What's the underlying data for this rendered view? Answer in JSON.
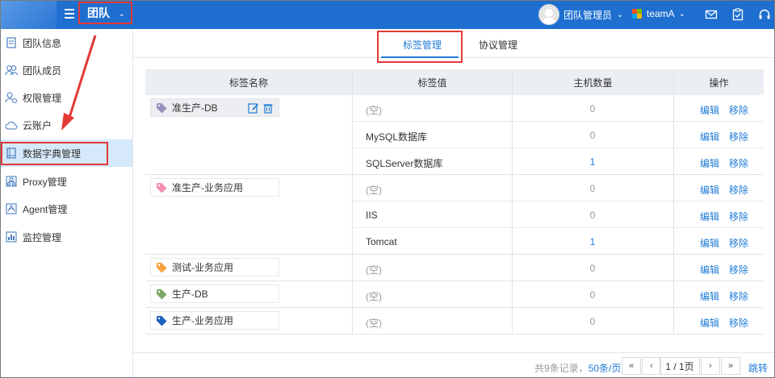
{
  "header": {
    "team_label": "团队",
    "user_name": "团队管理员",
    "team_name": "teamA",
    "icons": [
      "menu-icon",
      "mail-icon",
      "clipboard-icon",
      "headset-icon"
    ]
  },
  "sidebar": {
    "items": [
      {
        "label": "团队信息",
        "icon": "document-icon"
      },
      {
        "label": "团队成员",
        "icon": "people-icon"
      },
      {
        "label": "权限管理",
        "icon": "user-gear-icon"
      },
      {
        "label": "云账户",
        "icon": "cloud-icon"
      },
      {
        "label": "数据字典管理",
        "icon": "book-icon"
      },
      {
        "label": "Proxy管理",
        "icon": "network-icon"
      },
      {
        "label": "Agent管理",
        "icon": "agent-icon"
      },
      {
        "label": "监控管理",
        "icon": "monitor-icon"
      }
    ],
    "active_index": 4
  },
  "tabs": {
    "items": [
      {
        "label": "标签管理"
      },
      {
        "label": "协议管理"
      }
    ],
    "active_index": 0
  },
  "table": {
    "headers": [
      "标签名称",
      "标签值",
      "主机数量",
      "操作"
    ],
    "edit_label": "编辑",
    "remove_label": "移除",
    "groups": [
      {
        "name": "准生产-DB",
        "color": "#9b8fbf",
        "rows": [
          {
            "value": "(空)",
            "count": "0",
            "empty": true,
            "count_link": false
          },
          {
            "value": "MySQL数据库",
            "count": "0",
            "empty": false,
            "count_link": false
          },
          {
            "value": "SQLServer数据库",
            "count": "1",
            "empty": false,
            "count_link": true
          }
        ]
      },
      {
        "name": "准生产-业务应用",
        "color": "#f48fb1",
        "rows": [
          {
            "value": "(空)",
            "count": "0",
            "empty": true,
            "count_link": false
          },
          {
            "value": "IIS",
            "count": "0",
            "empty": false,
            "count_link": false
          },
          {
            "value": "Tomcat",
            "count": "1",
            "empty": false,
            "count_link": true
          }
        ]
      },
      {
        "name": "测试-业务应用",
        "color": "#f5a33b",
        "rows": [
          {
            "value": "(空)",
            "count": "0",
            "empty": true,
            "count_link": false
          }
        ]
      },
      {
        "name": "生产-DB",
        "color": "#7fa86a",
        "rows": [
          {
            "value": "(空)",
            "count": "0",
            "empty": true,
            "count_link": false
          }
        ]
      },
      {
        "name": "生产-业务应用",
        "color": "#1f5fbf",
        "rows": [
          {
            "value": "(空)",
            "count": "0",
            "empty": true,
            "count_link": false
          }
        ]
      }
    ]
  },
  "pager": {
    "total_text": "共9条记录，",
    "page_size_text": "50条/页",
    "page_text": "1 / 1页",
    "jump_label": "跳转",
    "first": "«",
    "prev": "‹",
    "next": "›",
    "last": "»"
  },
  "colors": {
    "topbar": "#1e6fd0",
    "accent": "#1f7bd6",
    "highlight_box": "#e53935",
    "active_bg": "#d6e9fa"
  }
}
